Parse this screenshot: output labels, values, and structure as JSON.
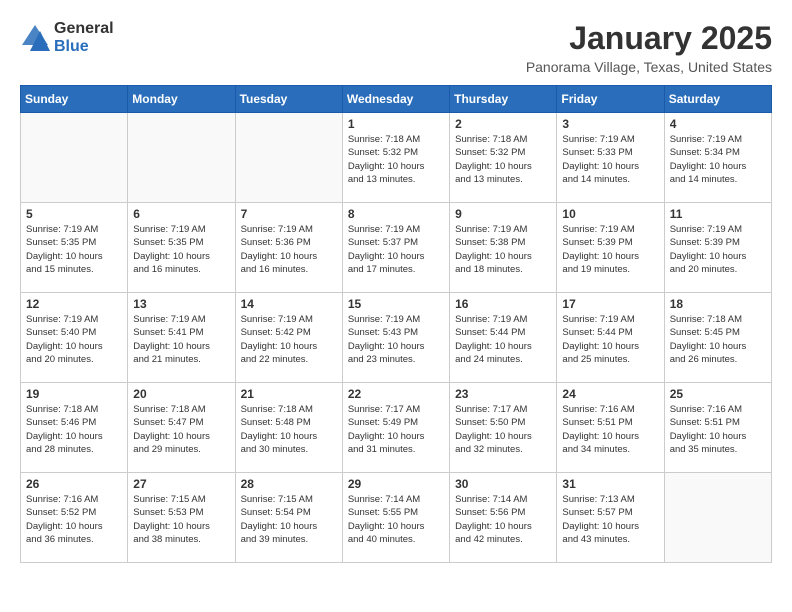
{
  "header": {
    "logo_general": "General",
    "logo_blue": "Blue",
    "month": "January 2025",
    "location": "Panorama Village, Texas, United States"
  },
  "weekdays": [
    "Sunday",
    "Monday",
    "Tuesday",
    "Wednesday",
    "Thursday",
    "Friday",
    "Saturday"
  ],
  "weeks": [
    [
      {
        "day": "",
        "info": ""
      },
      {
        "day": "",
        "info": ""
      },
      {
        "day": "",
        "info": ""
      },
      {
        "day": "1",
        "info": "Sunrise: 7:18 AM\nSunset: 5:32 PM\nDaylight: 10 hours\nand 13 minutes."
      },
      {
        "day": "2",
        "info": "Sunrise: 7:18 AM\nSunset: 5:32 PM\nDaylight: 10 hours\nand 13 minutes."
      },
      {
        "day": "3",
        "info": "Sunrise: 7:19 AM\nSunset: 5:33 PM\nDaylight: 10 hours\nand 14 minutes."
      },
      {
        "day": "4",
        "info": "Sunrise: 7:19 AM\nSunset: 5:34 PM\nDaylight: 10 hours\nand 14 minutes."
      }
    ],
    [
      {
        "day": "5",
        "info": "Sunrise: 7:19 AM\nSunset: 5:35 PM\nDaylight: 10 hours\nand 15 minutes."
      },
      {
        "day": "6",
        "info": "Sunrise: 7:19 AM\nSunset: 5:35 PM\nDaylight: 10 hours\nand 16 minutes."
      },
      {
        "day": "7",
        "info": "Sunrise: 7:19 AM\nSunset: 5:36 PM\nDaylight: 10 hours\nand 16 minutes."
      },
      {
        "day": "8",
        "info": "Sunrise: 7:19 AM\nSunset: 5:37 PM\nDaylight: 10 hours\nand 17 minutes."
      },
      {
        "day": "9",
        "info": "Sunrise: 7:19 AM\nSunset: 5:38 PM\nDaylight: 10 hours\nand 18 minutes."
      },
      {
        "day": "10",
        "info": "Sunrise: 7:19 AM\nSunset: 5:39 PM\nDaylight: 10 hours\nand 19 minutes."
      },
      {
        "day": "11",
        "info": "Sunrise: 7:19 AM\nSunset: 5:39 PM\nDaylight: 10 hours\nand 20 minutes."
      }
    ],
    [
      {
        "day": "12",
        "info": "Sunrise: 7:19 AM\nSunset: 5:40 PM\nDaylight: 10 hours\nand 20 minutes."
      },
      {
        "day": "13",
        "info": "Sunrise: 7:19 AM\nSunset: 5:41 PM\nDaylight: 10 hours\nand 21 minutes."
      },
      {
        "day": "14",
        "info": "Sunrise: 7:19 AM\nSunset: 5:42 PM\nDaylight: 10 hours\nand 22 minutes."
      },
      {
        "day": "15",
        "info": "Sunrise: 7:19 AM\nSunset: 5:43 PM\nDaylight: 10 hours\nand 23 minutes."
      },
      {
        "day": "16",
        "info": "Sunrise: 7:19 AM\nSunset: 5:44 PM\nDaylight: 10 hours\nand 24 minutes."
      },
      {
        "day": "17",
        "info": "Sunrise: 7:19 AM\nSunset: 5:44 PM\nDaylight: 10 hours\nand 25 minutes."
      },
      {
        "day": "18",
        "info": "Sunrise: 7:18 AM\nSunset: 5:45 PM\nDaylight: 10 hours\nand 26 minutes."
      }
    ],
    [
      {
        "day": "19",
        "info": "Sunrise: 7:18 AM\nSunset: 5:46 PM\nDaylight: 10 hours\nand 28 minutes."
      },
      {
        "day": "20",
        "info": "Sunrise: 7:18 AM\nSunset: 5:47 PM\nDaylight: 10 hours\nand 29 minutes."
      },
      {
        "day": "21",
        "info": "Sunrise: 7:18 AM\nSunset: 5:48 PM\nDaylight: 10 hours\nand 30 minutes."
      },
      {
        "day": "22",
        "info": "Sunrise: 7:17 AM\nSunset: 5:49 PM\nDaylight: 10 hours\nand 31 minutes."
      },
      {
        "day": "23",
        "info": "Sunrise: 7:17 AM\nSunset: 5:50 PM\nDaylight: 10 hours\nand 32 minutes."
      },
      {
        "day": "24",
        "info": "Sunrise: 7:16 AM\nSunset: 5:51 PM\nDaylight: 10 hours\nand 34 minutes."
      },
      {
        "day": "25",
        "info": "Sunrise: 7:16 AM\nSunset: 5:51 PM\nDaylight: 10 hours\nand 35 minutes."
      }
    ],
    [
      {
        "day": "26",
        "info": "Sunrise: 7:16 AM\nSunset: 5:52 PM\nDaylight: 10 hours\nand 36 minutes."
      },
      {
        "day": "27",
        "info": "Sunrise: 7:15 AM\nSunset: 5:53 PM\nDaylight: 10 hours\nand 38 minutes."
      },
      {
        "day": "28",
        "info": "Sunrise: 7:15 AM\nSunset: 5:54 PM\nDaylight: 10 hours\nand 39 minutes."
      },
      {
        "day": "29",
        "info": "Sunrise: 7:14 AM\nSunset: 5:55 PM\nDaylight: 10 hours\nand 40 minutes."
      },
      {
        "day": "30",
        "info": "Sunrise: 7:14 AM\nSunset: 5:56 PM\nDaylight: 10 hours\nand 42 minutes."
      },
      {
        "day": "31",
        "info": "Sunrise: 7:13 AM\nSunset: 5:57 PM\nDaylight: 10 hours\nand 43 minutes."
      },
      {
        "day": "",
        "info": ""
      }
    ]
  ]
}
